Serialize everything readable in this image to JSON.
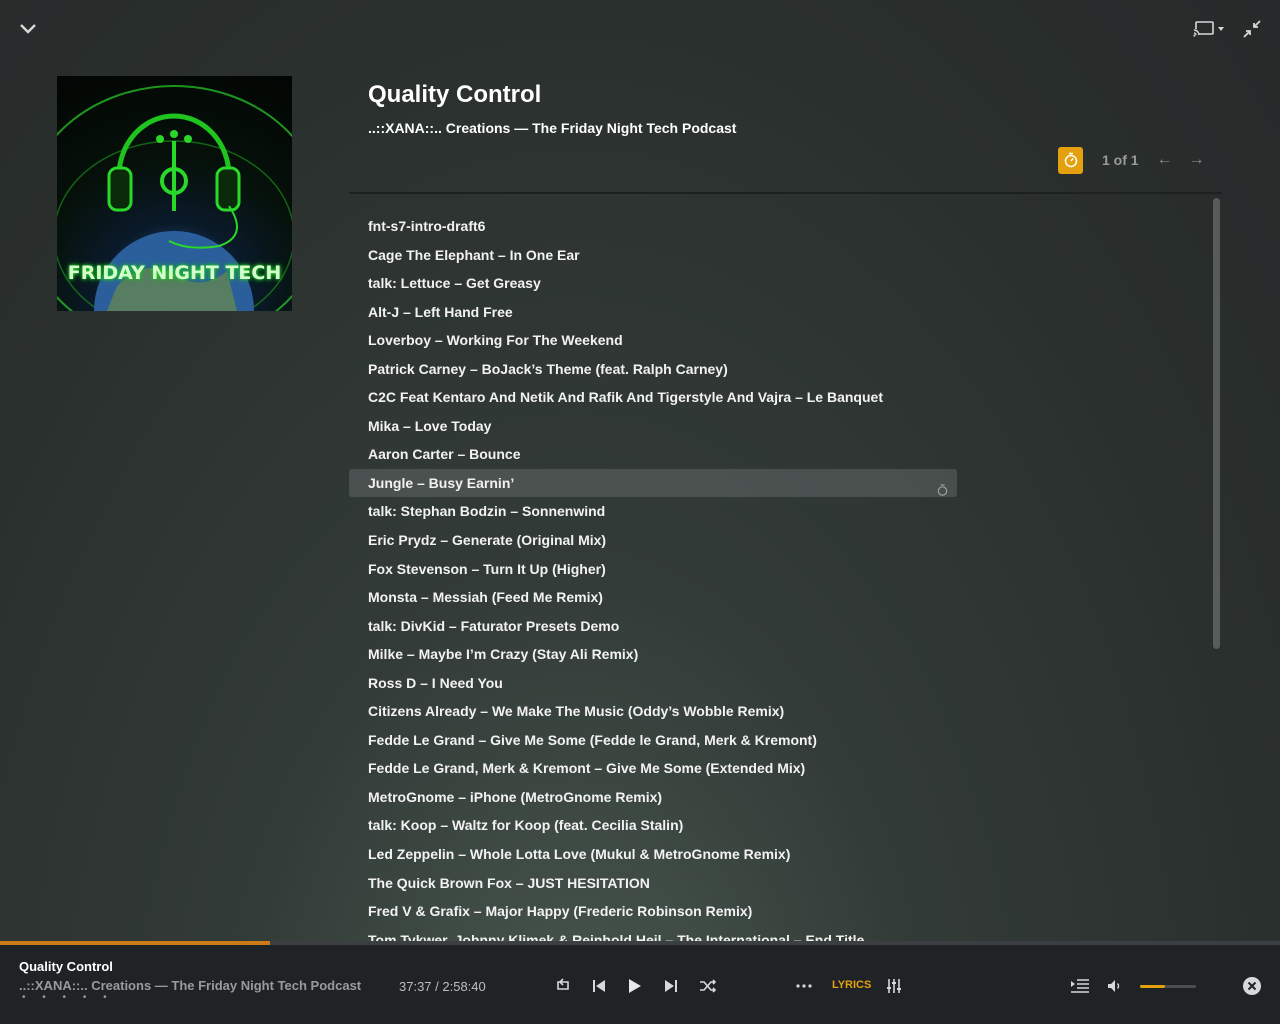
{
  "header": {
    "collapse_icon": "chevron-down-icon",
    "cast_icon": "cast-icon",
    "exit_fullscreen_icon": "compress-icon"
  },
  "album": {
    "cover_text": "FRIDAY NIGHT TECH",
    "title": "Quality Control",
    "subtitle": "..::XANA::.. Creations — The Friday Night Tech Podcast"
  },
  "pager": {
    "timer_icon": "stopwatch-icon",
    "count_text": "1 of 1",
    "prev_label": "←",
    "next_label": "→",
    "accent_color": "#e5a00d"
  },
  "tracks": [
    {
      "label": "fnt-s7-intro-draft6"
    },
    {
      "label": "Cage The Elephant – In One Ear"
    },
    {
      "label": "talk: Lettuce – Get Greasy"
    },
    {
      "label": "Alt-J – Left Hand Free"
    },
    {
      "label": "Loverboy – Working For The Weekend"
    },
    {
      "label": "Patrick Carney – BoJack’s Theme (feat. Ralph Carney)"
    },
    {
      "label": "C2C Feat Kentaro And Netik And Rafik And Tigerstyle And Vajra – Le Banquet"
    },
    {
      "label": "Mika – Love Today"
    },
    {
      "label": "Aaron Carter – Bounce"
    },
    {
      "label": "Jungle – Busy Earnin’",
      "active": true
    },
    {
      "label": "talk: Stephan Bodzin – Sonnenwind"
    },
    {
      "label": "Eric Prydz – Generate (Original Mix)"
    },
    {
      "label": "Fox Stevenson – Turn It Up (Higher)"
    },
    {
      "label": "Monsta – Messiah (Feed Me Remix)"
    },
    {
      "label": "talk: DivKid – Faturator Presets Demo"
    },
    {
      "label": "Milke – Maybe I’m Crazy (Stay Ali Remix)"
    },
    {
      "label": "Ross D – I Need You"
    },
    {
      "label": "Citizens Already – We Make The Music (Oddy’s Wobble Remix)"
    },
    {
      "label": "Fedde Le Grand – Give Me Some (Fedde le Grand, Merk & Kremont)"
    },
    {
      "label": "Fedde Le Grand, Merk & Kremont – Give Me Some (Extended Mix)"
    },
    {
      "label": "MetroGnome – iPhone (MetroGnome Remix)"
    },
    {
      "label": "talk: Koop – Waltz for Koop (feat. Cecilia Stalin)"
    },
    {
      "label": "Led Zeppelin – Whole Lotta Love (Mukul & MetroGnome Remix)"
    },
    {
      "label": "The Quick Brown Fox – JUST HESITATION"
    },
    {
      "label": "Fred V & Grafix – Major Happy (Frederic Robinson Remix)"
    },
    {
      "label": "Tom Tykwer, Johnny Klimek & Reinhold Heil – The International – End Title"
    }
  ],
  "player": {
    "title": "Quality Control",
    "subtitle": "..::XANA::.. Creations — The Friday Night Tech Podcast",
    "dots": "• • • • •",
    "time_text": "37:37 / 2:58:40",
    "progress_fraction": 0.2109,
    "progress_color": "#cc7b19",
    "lyrics_label": "LYRICS",
    "volume_fraction": 0.45,
    "icons": [
      "repeat-icon",
      "previous-icon",
      "play-icon",
      "next-icon",
      "shuffle-icon",
      "more-icon",
      "equalizer-icon",
      "queue-icon",
      "volume-icon",
      "close-icon"
    ]
  }
}
